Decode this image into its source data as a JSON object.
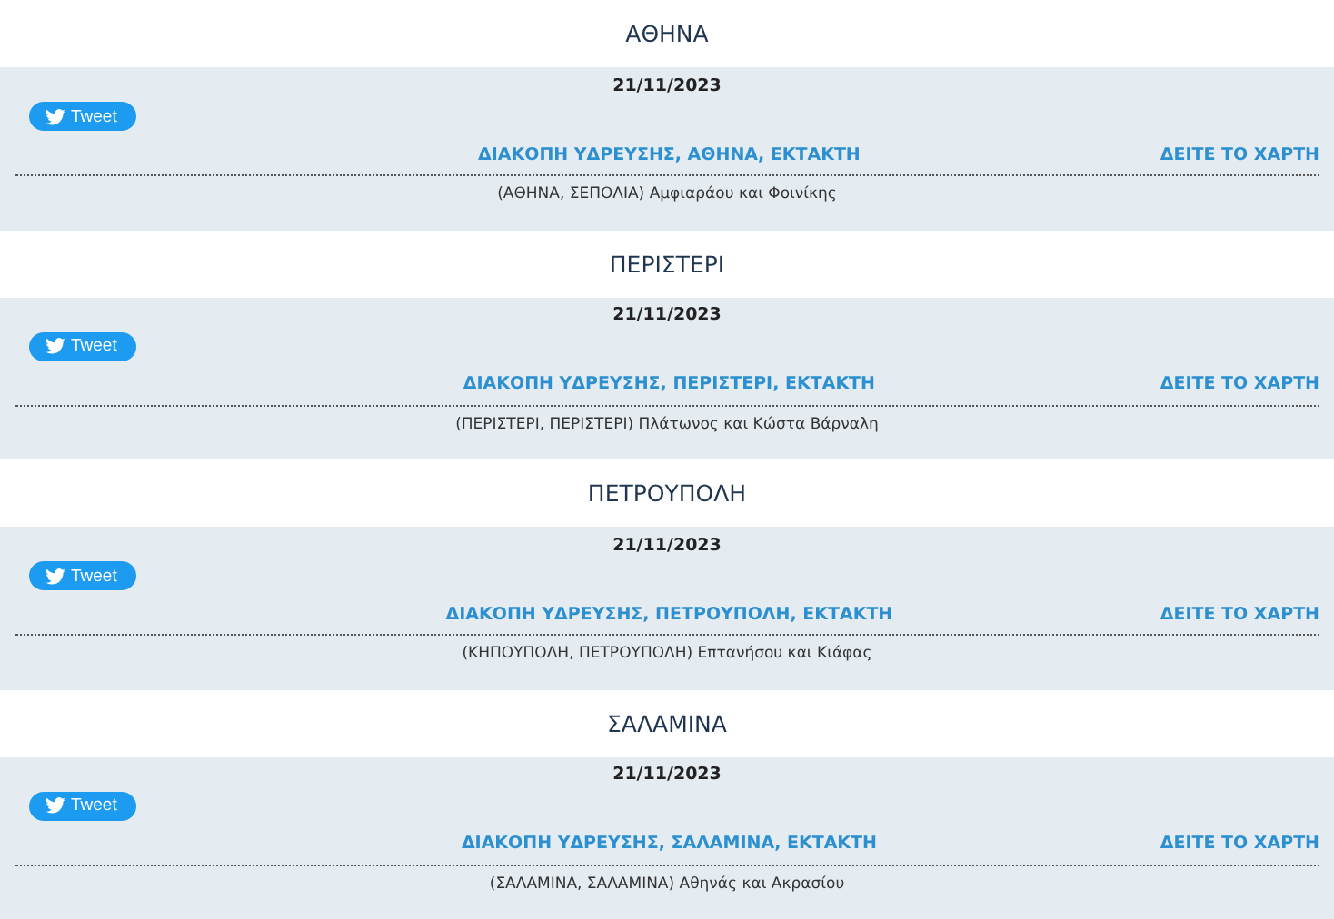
{
  "sections": [
    {
      "city": "ΑΘΗΝΑ",
      "date": "21/11/2023",
      "tweet": "Tweet",
      "title": "ΔΙΑΚΟΠΗ ΥΔΡΕΥΣΗΣ, ΑΘΗΝΑ, ΕΚΤΑΚΤΗ",
      "map_link": "ΔΕΙΤΕ ΤΟ ΧΑΡΤΗ",
      "address": "(ΑΘΗΝΑ, ΣΕΠΟΛΙΑ) Αμφιαράου και Φοινίκης"
    },
    {
      "city": "ΠΕΡΙΣΤΕΡΙ",
      "date": "21/11/2023",
      "tweet": "Tweet",
      "title": "ΔΙΑΚΟΠΗ ΥΔΡΕΥΣΗΣ, ΠΕΡΙΣΤΕΡΙ, ΕΚΤΑΚΤΗ",
      "map_link": "ΔΕΙΤΕ ΤΟ ΧΑΡΤΗ",
      "address": "(ΠΕΡΙΣΤΕΡΙ, ΠΕΡΙΣΤΕΡΙ) Πλάτωνος και Κώστα Βάρναλη"
    },
    {
      "city": "ΠΕΤΡΟΥΠΟΛΗ",
      "date": "21/11/2023",
      "tweet": "Tweet",
      "title": "ΔΙΑΚΟΠΗ ΥΔΡΕΥΣΗΣ, ΠΕΤΡΟΥΠΟΛΗ, ΕΚΤΑΚΤΗ",
      "map_link": "ΔΕΙΤΕ ΤΟ ΧΑΡΤΗ",
      "address": "(ΚΗΠΟΥΠΟΛΗ, ΠΕΤΡΟΥΠΟΛΗ) Επτανήσου και Κιάφας"
    },
    {
      "city": "ΣΑΛΑΜΙΝΑ",
      "date": "21/11/2023",
      "tweet": "Tweet",
      "title": "ΔΙΑΚΟΠΗ ΥΔΡΕΥΣΗΣ, ΣΑΛΑΜΙΝΑ, ΕΚΤΑΚΤΗ",
      "map_link": "ΔΕΙΤΕ ΤΟ ΧΑΡΤΗ",
      "address": "(ΣΑΛΑΜΙΝΑ, ΣΑΛΑΜΙΝΑ) Αθηνάς και Ακρασίου"
    }
  ]
}
